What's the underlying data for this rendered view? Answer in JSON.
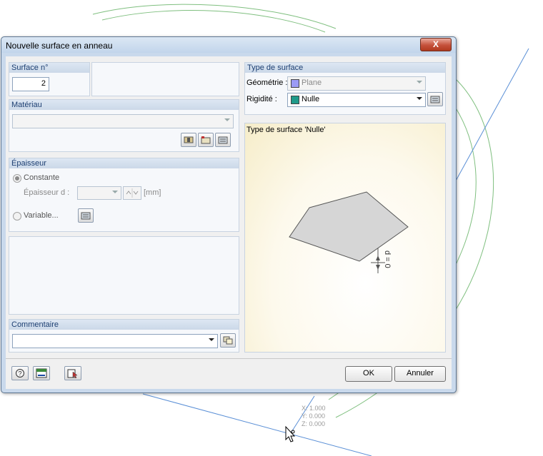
{
  "dialog": {
    "title": "Nouvelle surface en anneau",
    "close_label": "X"
  },
  "surface_no": {
    "label": "Surface n°",
    "value": "2"
  },
  "material": {
    "label": "Matériau",
    "value": ""
  },
  "thickness": {
    "label": "Épaisseur",
    "constant_label": "Constante",
    "thickness_label": "Épaisseur d :",
    "thickness_value": "",
    "unit": "[mm]",
    "variable_label": "Variable..."
  },
  "comment": {
    "label": "Commentaire",
    "value": ""
  },
  "surface_type": {
    "label": "Type de surface",
    "geometry_label": "Géométrie :",
    "geometry_value": "Plane",
    "geometry_color": "#9b9bf5",
    "stiffness_label": "Rigidité :",
    "stiffness_value": "Nulle",
    "stiffness_color": "#1f9a8a"
  },
  "preview": {
    "caption": "Type de surface 'Nulle'",
    "dimension_label": "d = 0"
  },
  "footer": {
    "ok_label": "OK",
    "cancel_label": "Annuler"
  },
  "coordinates": {
    "x": "X: 1.000",
    "y": "Y: 0.000",
    "z": "Z: 0.000"
  }
}
